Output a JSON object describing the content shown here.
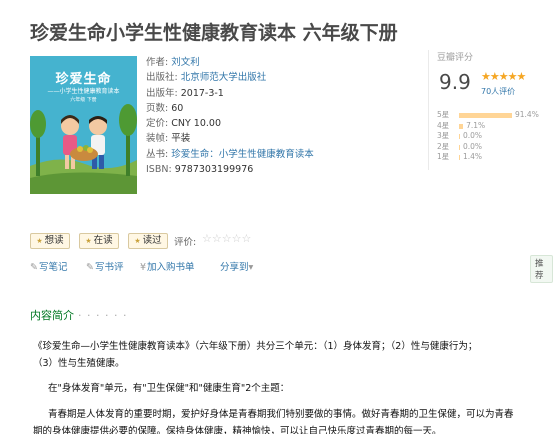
{
  "title": "珍爱生命小学生性健康教育读本 六年级下册",
  "cover": {
    "title": "珍爱生命",
    "subtitle": "——小学生性健康教育读本",
    "grade": "六年级 下册"
  },
  "info": {
    "author_label": "作者:",
    "author": "刘文利",
    "publisher_label": "出版社:",
    "publisher": "北京师范大学出版社",
    "pubdate_label": "出版年:",
    "pubdate": "2017-3-1",
    "pages_label": "页数:",
    "pages": "60",
    "price_label": "定价:",
    "price": "CNY 10.00",
    "binding_label": "装帧:",
    "binding": "平装",
    "series_label": "丛书:",
    "series": "珍爱生命：小学生性健康教育读本",
    "isbn_label": "ISBN:",
    "isbn": "9787303199976"
  },
  "rating": {
    "label": "豆瓣评分",
    "score": "9.9",
    "stars": "★★★★★",
    "count": "70人评价",
    "distribution": [
      {
        "label": "5星",
        "percent": "91.4%",
        "value": 91.4
      },
      {
        "label": "4星",
        "percent": "7.1%",
        "value": 7.1
      },
      {
        "label": "3星",
        "percent": "0.0%",
        "value": 0.0
      },
      {
        "label": "2星",
        "percent": "0.0%",
        "value": 0.0
      },
      {
        "label": "1星",
        "percent": "1.4%",
        "value": 1.4
      }
    ]
  },
  "actions": {
    "want": "想读",
    "reading": "在读",
    "read": "读过",
    "rate_label": "评价:",
    "rate_stars": "☆☆☆☆☆"
  },
  "links": {
    "write_note": "写笔记",
    "write_review": "写书评",
    "add_list": "加入购书单",
    "share": "分享到",
    "share_arrow": "▾",
    "recommend": "推荐"
  },
  "section": {
    "title": "内容简介",
    "dots": "· · · · · ·"
  },
  "intro": {
    "p1_line1": "《珍爱生命—小学生性健康教育读本》（六年级下册）共分三个单元：（1）身体发育；（2）性与健康行为；",
    "p1_line2": "（3）性与生殖健康。",
    "p2": "在\"身体发育\"单元，有\"卫生保健\"和\"健康生育\"2个主题：",
    "p3_line1": "青春期是人体发育的重要时期，爱护好身体是青春期我们特别要做的事情。做好青春期的卫生保健，可以为青春",
    "p3_line2": "期的身体健康提供必要的保障。保持身体健康，精神愉快，可以让自己快乐度过青春期的每一天。"
  },
  "colors": {
    "link": "#3377aa",
    "star": "#f5a623",
    "bar": "#ffd596",
    "section": "#007722",
    "cover_bg": "#45b3cf"
  }
}
